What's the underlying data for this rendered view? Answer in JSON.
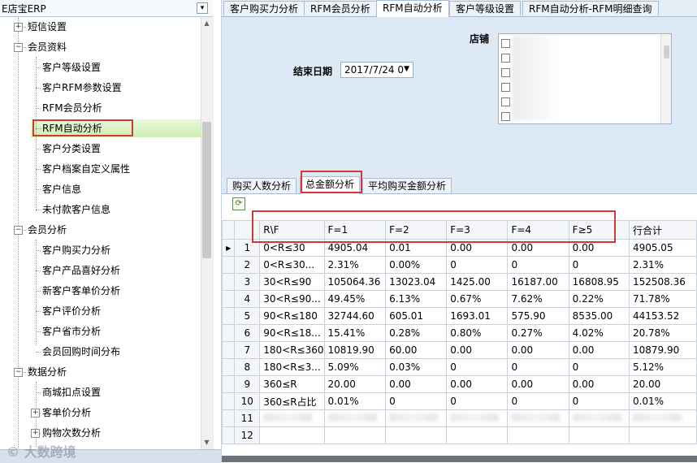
{
  "tree": {
    "title": "E店宝ERP",
    "items": [
      {
        "label": "短信设置",
        "level": 1,
        "expander": "+"
      },
      {
        "label": "会员资料",
        "level": 1,
        "expander": "−"
      },
      {
        "label": "客户等级设置",
        "level": 2
      },
      {
        "label": "客户RFM参数设置",
        "level": 2
      },
      {
        "label": "RFM会员分析",
        "level": 2
      },
      {
        "label": "RFM自动分析",
        "level": 2,
        "selected": true
      },
      {
        "label": "客户分类设置",
        "level": 2
      },
      {
        "label": "客户档案自定义属性",
        "level": 2
      },
      {
        "label": "客户信息",
        "level": 2
      },
      {
        "label": "未付款客户信息",
        "level": 2
      },
      {
        "label": "会员分析",
        "level": 1,
        "expander": "−"
      },
      {
        "label": "客户购买力分析",
        "level": 2
      },
      {
        "label": "客户产品喜好分析",
        "level": 2
      },
      {
        "label": "新客户客单价分析",
        "level": 2
      },
      {
        "label": "客户评价分析",
        "level": 2
      },
      {
        "label": "客户省市分析",
        "level": 2
      },
      {
        "label": "会员回购时间分布",
        "level": 2
      },
      {
        "label": "数据分析",
        "level": 1,
        "expander": "−"
      },
      {
        "label": "商城扣点设置",
        "level": 2
      },
      {
        "label": "客单价分析",
        "level": 2,
        "expander": "+"
      },
      {
        "label": "购物次数分析",
        "level": 2,
        "expander": "+"
      }
    ]
  },
  "tabs": [
    "客户购买力分析",
    "RFM会员分析",
    "RFM自动分析",
    "客户等级设置",
    "RFM自动分析-RFM明细查询"
  ],
  "active_tab": 2,
  "filter": {
    "end_date_label": "结束日期",
    "end_date_value": "2017/7/24 0",
    "shop_label": "店铺"
  },
  "subtabs": [
    "购买人数分析",
    "总金额分析",
    "平均购买金额分析"
  ],
  "active_subtab": 1,
  "grid": {
    "headers": [
      "R\\F",
      "F=1",
      "F=2",
      "F=3",
      "F=4",
      "F≥5",
      "行合计"
    ],
    "rows": [
      {
        "n": "1",
        "cells": [
          "0<R≤30",
          "4905.04",
          "0.01",
          "0.00",
          "0.00",
          "0.00",
          "4905.05"
        ],
        "current": true
      },
      {
        "n": "2",
        "cells": [
          "0<R≤30...",
          "2.31%",
          "0.00%",
          "0",
          "0",
          "0",
          "2.31%"
        ]
      },
      {
        "n": "3",
        "cells": [
          "30<R≤90",
          "105064.36",
          "13023.04",
          "1425.00",
          "16187.00",
          "16808.95",
          "152508.36"
        ]
      },
      {
        "n": "4",
        "cells": [
          "30<R≤90...",
          "49.45%",
          "6.13%",
          "0.67%",
          "7.62%",
          "0.22%",
          "71.78%"
        ]
      },
      {
        "n": "5",
        "cells": [
          "90<R≤180",
          "32744.60",
          "605.01",
          "1693.01",
          "575.90",
          "8535.00",
          "44153.52"
        ]
      },
      {
        "n": "6",
        "cells": [
          "90<R≤18...",
          "15.41%",
          "0.28%",
          "0.80%",
          "0.27%",
          "4.02%",
          "20.78%"
        ]
      },
      {
        "n": "7",
        "cells": [
          "180<R≤360",
          "10819.90",
          "60.00",
          "0.00",
          "0.00",
          "0.00",
          "10879.90"
        ]
      },
      {
        "n": "8",
        "cells": [
          "180<R≤3...",
          "5.09%",
          "0.03%",
          "0",
          "0",
          "0",
          "5.12%"
        ]
      },
      {
        "n": "9",
        "cells": [
          "360≤R",
          "20.00",
          "0.00",
          "0.00",
          "0.00",
          "0.00",
          "20.00"
        ]
      },
      {
        "n": "10",
        "cells": [
          "360≤R占比",
          "0.01%",
          "0",
          "0",
          "0",
          "0",
          "0.01%"
        ]
      },
      {
        "n": "11",
        "cells": [
          "",
          "",
          "",
          "",
          "",
          "",
          ""
        ],
        "blurred": true
      },
      {
        "n": "12",
        "cells": [
          "",
          "",
          "",
          "",
          "",
          "",
          ""
        ]
      }
    ]
  },
  "watermark": "© 大数跨境",
  "colors": {
    "highlight_box": "#d03a33",
    "selected_row": "#cdeeb3",
    "panel_bg": "#dde9f5"
  }
}
